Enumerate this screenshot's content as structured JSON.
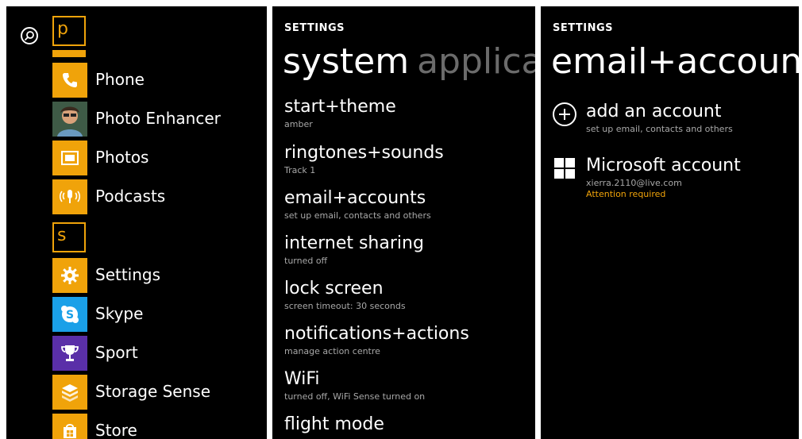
{
  "accent_color": "#f0a30a",
  "app_list": {
    "letters": {
      "p": "p",
      "s": "s"
    },
    "apps": [
      {
        "label": "Phone",
        "icon": "phone-icon"
      },
      {
        "label": "Photo Enhancer",
        "icon": "photo-enhancer-avatar-icon"
      },
      {
        "label": "Photos",
        "icon": "photos-icon"
      },
      {
        "label": "Podcasts",
        "icon": "podcasts-icon"
      },
      {
        "label": "Settings",
        "icon": "gear-icon"
      },
      {
        "label": "Skype",
        "icon": "skype-icon"
      },
      {
        "label": "Sport",
        "icon": "trophy-icon"
      },
      {
        "label": "Storage Sense",
        "icon": "storage-sense-icon"
      },
      {
        "label": "Store",
        "icon": "store-bag-icon"
      }
    ]
  },
  "system_page": {
    "header": "SETTINGS",
    "pivot_active": "system",
    "pivot_next": "applicat",
    "items": [
      {
        "title": "start+theme",
        "subtitle": "amber"
      },
      {
        "title": "ringtones+sounds",
        "subtitle": "Track 1"
      },
      {
        "title": "email+accounts",
        "subtitle": "set up email, contacts and others"
      },
      {
        "title": "internet sharing",
        "subtitle": "turned off"
      },
      {
        "title": "lock screen",
        "subtitle": "screen timeout: 30 seconds"
      },
      {
        "title": "notifications+actions",
        "subtitle": "manage action centre"
      },
      {
        "title": "WiFi",
        "subtitle": "turned off, WiFi Sense turned on"
      },
      {
        "title": "flight mode",
        "subtitle": ""
      }
    ]
  },
  "accounts_page": {
    "header": "SETTINGS",
    "title": "email+account",
    "add_account": {
      "title": "add an account",
      "subtitle": "set up email, contacts and others"
    },
    "microsoft_account": {
      "title": "Microsoft account",
      "email": "xierra.2110@live.com",
      "status": "Attention required"
    }
  }
}
